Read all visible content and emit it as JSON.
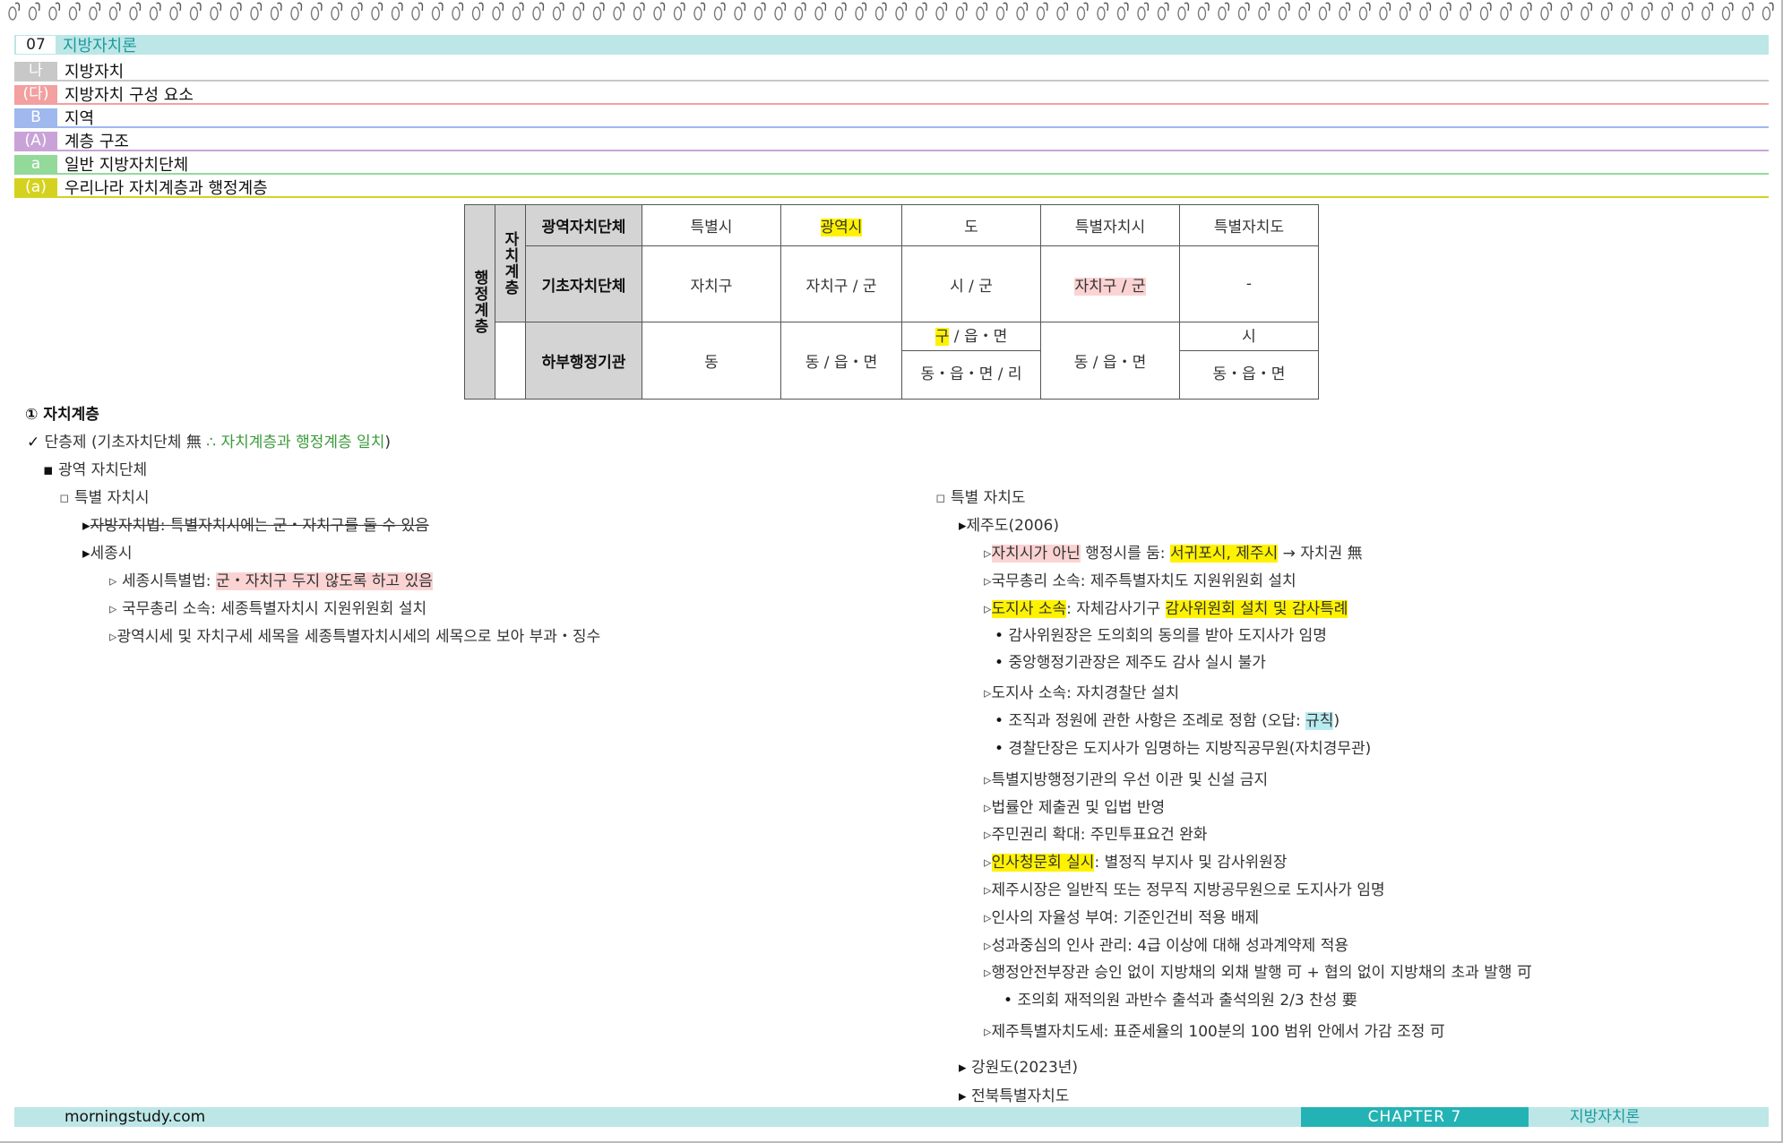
{
  "header": {
    "chapter_num": "07",
    "chapter_title": "지방자치론",
    "rows": [
      {
        "tag": "나",
        "title": "지방자치",
        "color": "#c8c8c8"
      },
      {
        "tag": "(다)",
        "title": "지방자치 구성 요소",
        "color": "#f3a0a0"
      },
      {
        "tag": "B",
        "title": "지역",
        "color": "#9fb8ee"
      },
      {
        "tag": "(A)",
        "title": "계층 구조",
        "color": "#c9a3d8"
      },
      {
        "tag": "a",
        "title": "일반 지방자치단체",
        "color": "#93d99a"
      },
      {
        "tag": "(a)",
        "title": "우리나라 자치계층과 행정계층",
        "color": "#d4d21e"
      }
    ]
  },
  "table": {
    "admin_label": "행정계층",
    "auto_label": "자치계층",
    "row1_head": "광역자치단체",
    "row1": [
      "특별시",
      "광역시",
      "도",
      "특별자치시",
      "특별자치도"
    ],
    "row2_head": "기초자치단체",
    "row2": [
      "자치구",
      "자치구 / 군",
      "시 / 군",
      "자치구 / 군",
      "-"
    ],
    "row3_head": "하부행정기관",
    "row3_c1": "동",
    "row3_c2": "동 / 읍・면",
    "row3_c3_top_gu": "구",
    "row3_c3_top_rest": " / 읍・면",
    "row3_c3_bottom": "동・읍・면 / 리",
    "row3_c4": "동 / 읍・면",
    "row3_c5_top": "시",
    "row3_c5_bottom": "동・읍・면"
  },
  "left": {
    "section": "① 자치계층",
    "check_mark": "✓",
    "single": "단층제 (기초자치단체 無",
    "single_green": " ∴ 자치계층과 행정계층 일치",
    "single_close": ")",
    "wide": "광역 자치단체",
    "special_city": "특별 자치시",
    "law_strike": "자방자치법: 특별자치시에는 군・자치구를 둘 수 있음",
    "sejong": "세종시",
    "sejong_law_pre": "세종시특별법: ",
    "sejong_law_hl": "군・자치구 두지 않도록 하고 있음",
    "sejong_pm": "국무총리 소속: 세종특별자치시 지원위원회 설치",
    "sejong_tax": "광역시세 및 자치구세 세목을 세종특별자치시세의 세목으로 보아 부과・징수"
  },
  "right": {
    "special_prov": "특별 자치도",
    "jeju": "제주도(2006)",
    "j1_hl": "자치시가 아닌",
    "j1_mid": " 행정시를 둠: ",
    "j1_hl2": "서귀포시, 제주시",
    "j1_end": " → 자치권 無",
    "j2": "국무총리 소속: 제주특별자치도 지원위원회 설치",
    "j3_hl": "도지사 소속",
    "j3_mid": ": 자체감사기구 ",
    "j3_hl2": "감사위원회 설치 및 감사특례",
    "j3a": "감사위원장은 도의회의 동의를 받아 도지사가 임명",
    "j3b": "중앙행정기관장은 제주도 감사 실시 불가",
    "j4": "도지사 소속: 자치경찰단 설치",
    "j4a_pre": "조직과 정원에 관한 사항은 조례로 정함  (오답: ",
    "j4a_hl": "규칙",
    "j4a_end": ")",
    "j4b": "경찰단장은 도지사가 임명하는 지방직공무원(자치경무관)",
    "j5": "특별지방행정기관의 우선 이관 및 신설 금지",
    "j6": "법률안 제출권 및 입법 반영",
    "j7": "주민권리 확대: 주민투표요건 완화",
    "j8_hl": "인사청문회 실시",
    "j8_end": ": 별정직 부지사 및 감사위원장",
    "j9": "제주시장은 일반직 또는 정무직 지방공무원으로 도지사가 임명",
    "j10": "인사의 자율성 부여: 기준인건비 적용 배제",
    "j11": "성과중심의 인사 관리: 4급 이상에 대해 성과계약제 적용",
    "j12": "행정안전부장관 승인 없이 지방채의 외채 발행 可 + 협의 없이 지방채의 초과 발행 可",
    "j12a": "조의회 재적의원 과반수 출석과 출석의원 2/3 찬성 要",
    "j13": "제주특별자치도세: 표준세율의 100분의 100 범위 안에서 가감 조정 可",
    "gangwon": "강원도(2023년)",
    "jeonbuk": "전북특별자치도"
  },
  "footer": {
    "site": "morningstudy.com",
    "chapter": "CHAPTER 7",
    "subject": "지방자치론"
  },
  "colors": {
    "accent": "#24b3b4",
    "light_teal": "#bde6e7",
    "highlight_yellow": "#fff200",
    "highlight_pink": "#fbd3d3"
  }
}
